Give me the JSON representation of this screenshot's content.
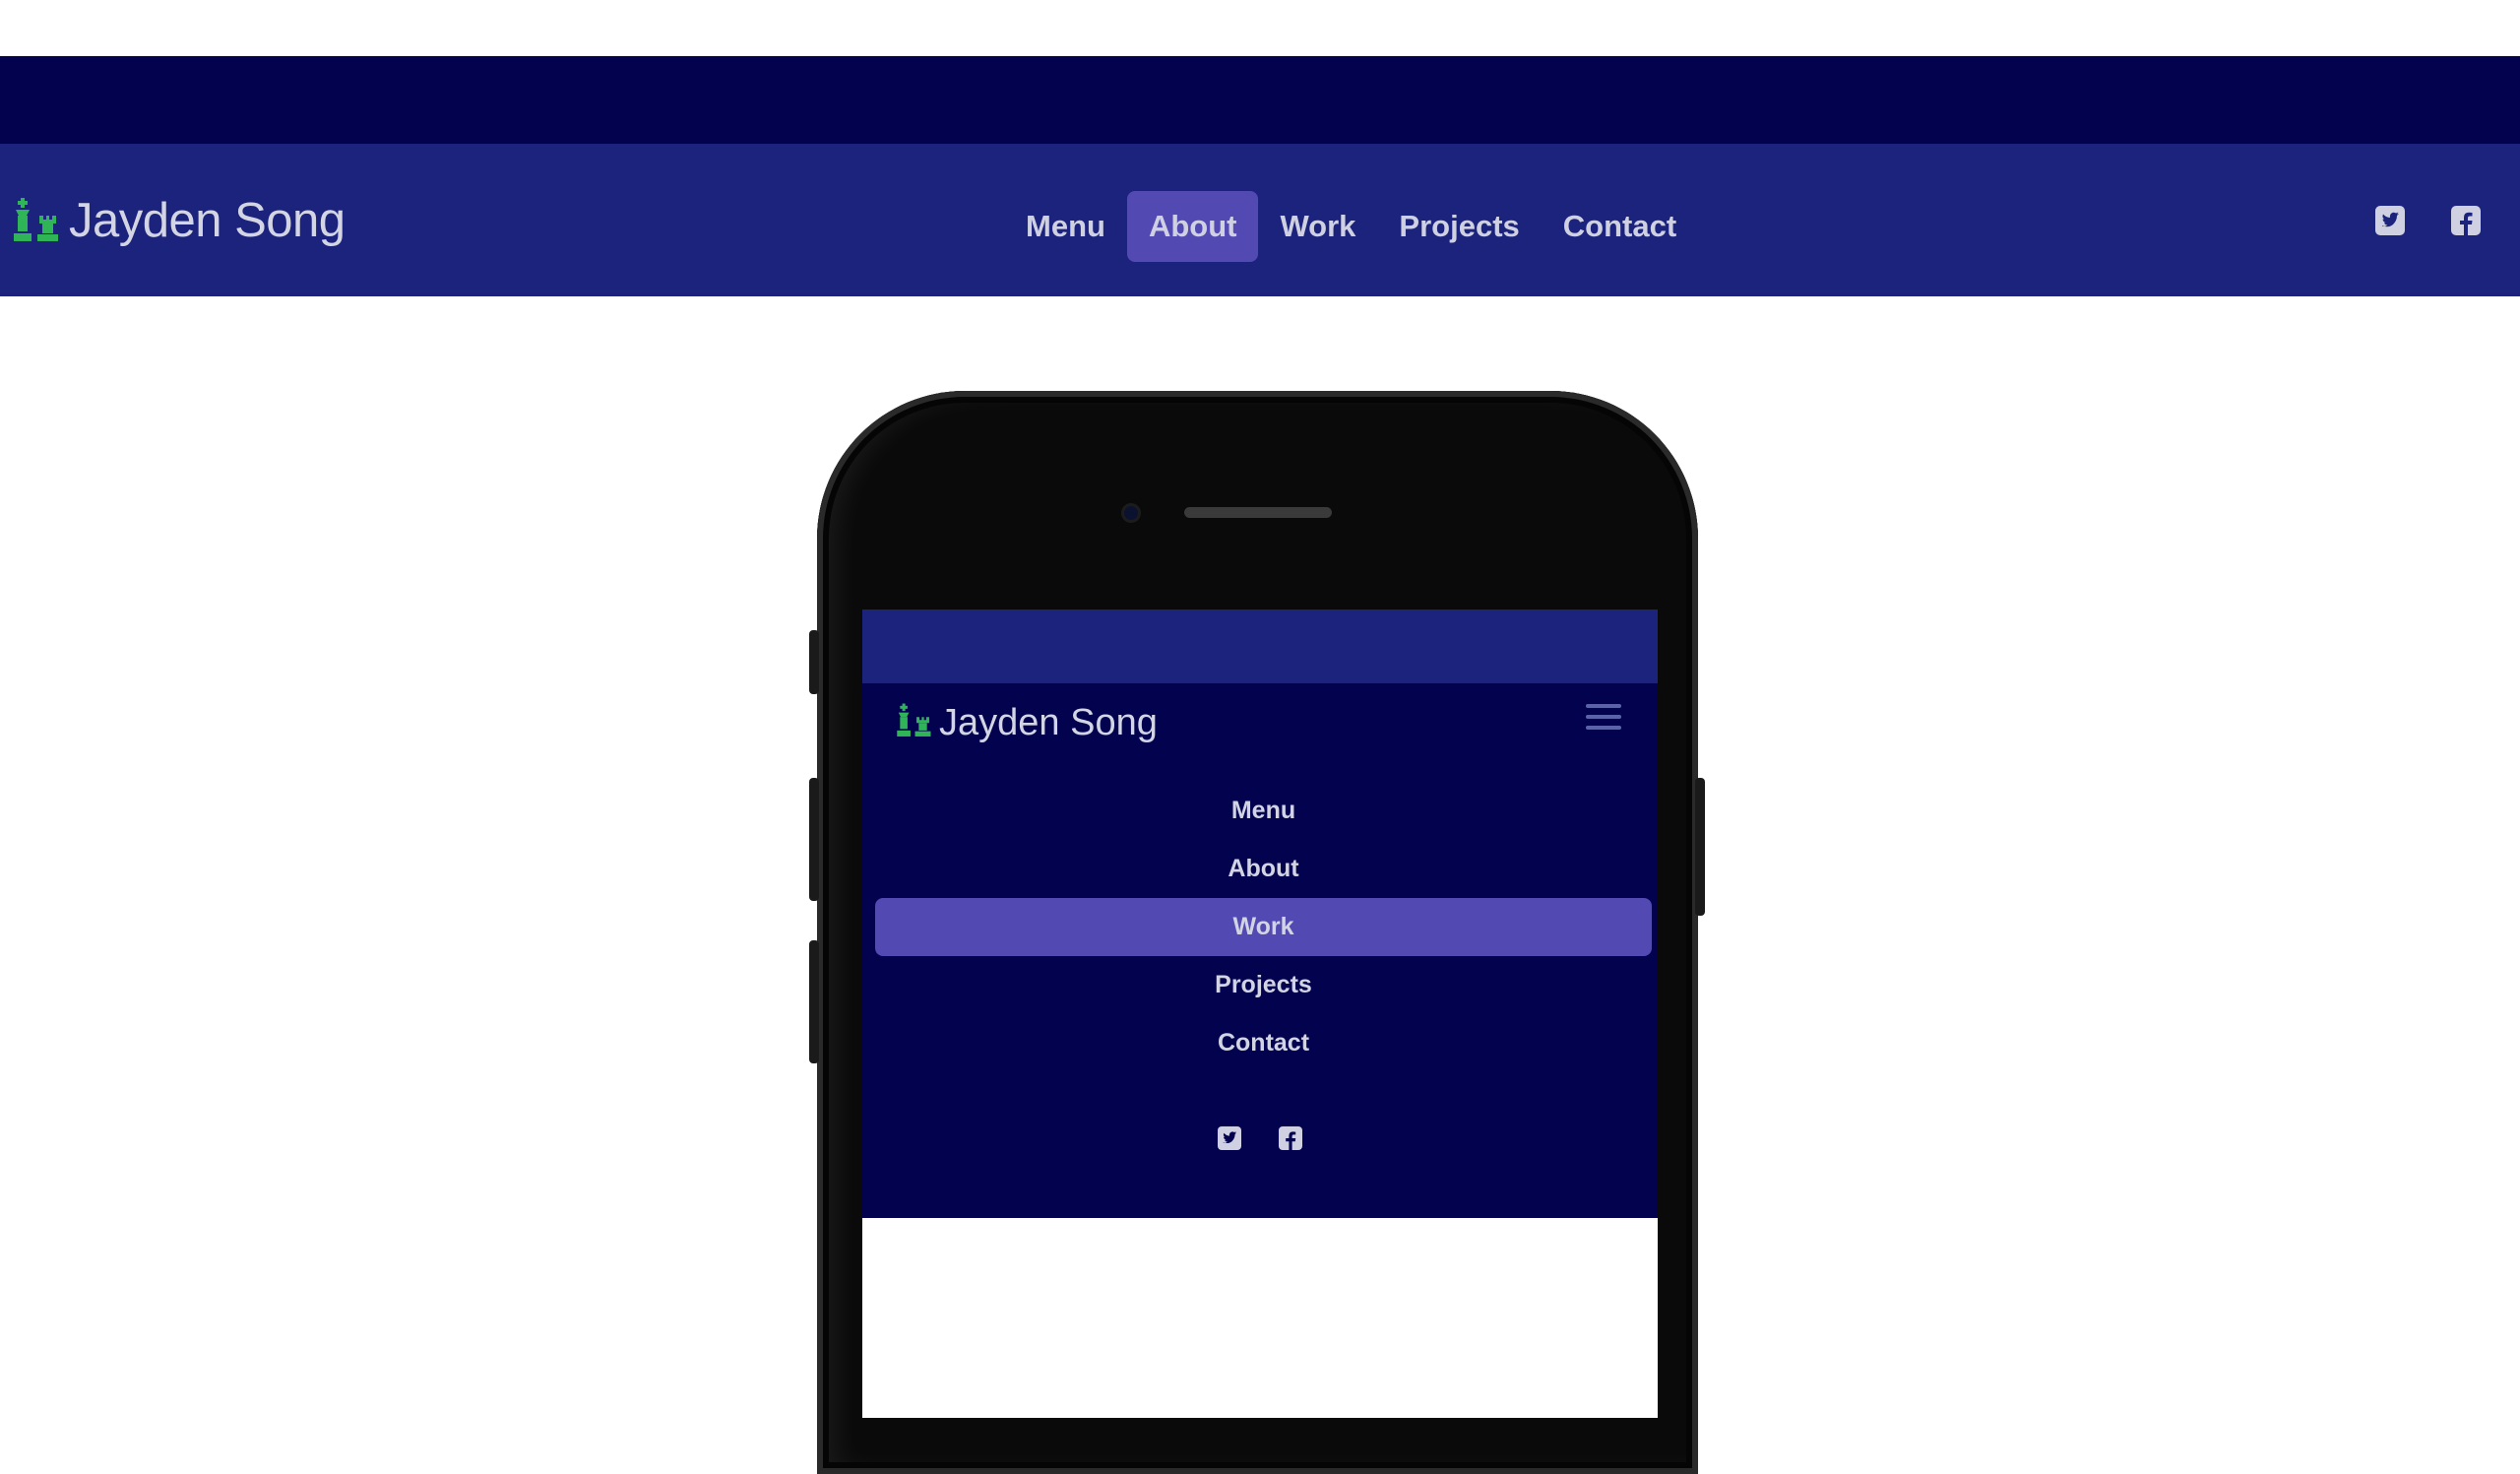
{
  "brand": {
    "name": "Jayden Song",
    "logo_icon": "chess-pieces-icon",
    "logo_color": "#2fb557"
  },
  "navbar": {
    "links": [
      {
        "label": "Menu",
        "active": false
      },
      {
        "label": "About",
        "active": true
      },
      {
        "label": "Work",
        "active": false
      },
      {
        "label": "Projects",
        "active": false
      },
      {
        "label": "Contact",
        "active": false
      }
    ],
    "social": [
      "twitter-square-icon",
      "facebook-square-icon"
    ]
  },
  "mobile_preview": {
    "brand": "Jayden Song",
    "links": [
      {
        "label": "Menu",
        "active": false
      },
      {
        "label": "About",
        "active": false
      },
      {
        "label": "Work",
        "active": true
      },
      {
        "label": "Projects",
        "active": false
      },
      {
        "label": "Contact",
        "active": false
      }
    ],
    "social": [
      "twitter-square-icon",
      "facebook-square-icon"
    ]
  },
  "colors": {
    "navbar_bg": "#1b237c",
    "dark_strip": "#02024f",
    "active_item": "#5249b2",
    "text": "#d3d5e4"
  }
}
